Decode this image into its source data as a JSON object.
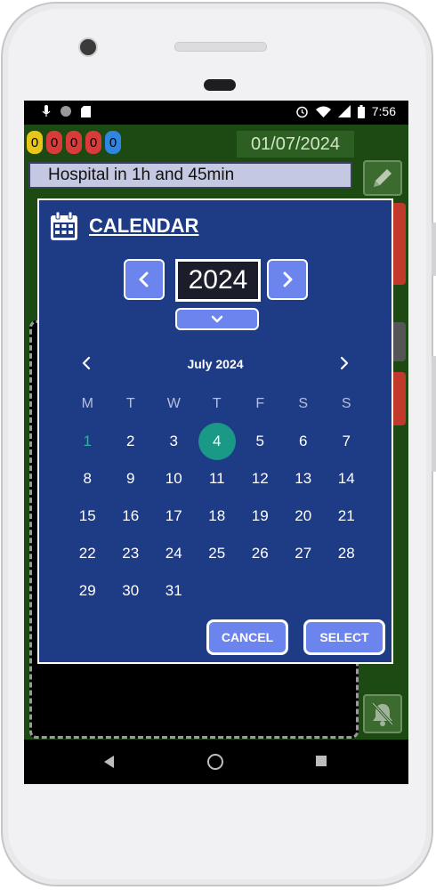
{
  "status_bar": {
    "time": "7:56"
  },
  "app": {
    "counters": [
      "0",
      "0",
      "0",
      "0",
      "0"
    ],
    "counter_colors": [
      "#e6c619",
      "#d93a3a",
      "#d93a3a",
      "#d93a3a",
      "#2f86e0"
    ],
    "date": "01/07/2024",
    "notice": "Hospital in 1h and 45min"
  },
  "dialog": {
    "title": "CALENDAR",
    "year": "2024",
    "month_label": "July 2024",
    "weekdays": [
      "M",
      "T",
      "W",
      "T",
      "F",
      "S",
      "S"
    ],
    "days": [
      "1",
      "2",
      "3",
      "4",
      "5",
      "6",
      "7",
      "8",
      "9",
      "10",
      "11",
      "12",
      "13",
      "14",
      "15",
      "16",
      "17",
      "18",
      "19",
      "20",
      "21",
      "22",
      "23",
      "24",
      "25",
      "26",
      "27",
      "28",
      "29",
      "30",
      "31"
    ],
    "today": "1",
    "selected": "4",
    "cancel_label": "CANCEL",
    "select_label": "SELECT"
  },
  "colors": {
    "dialog_bg": "#1e3b86",
    "accent": "#6c84ee",
    "selected_day": "#1a9987",
    "app_bg": "#1d4a12"
  }
}
